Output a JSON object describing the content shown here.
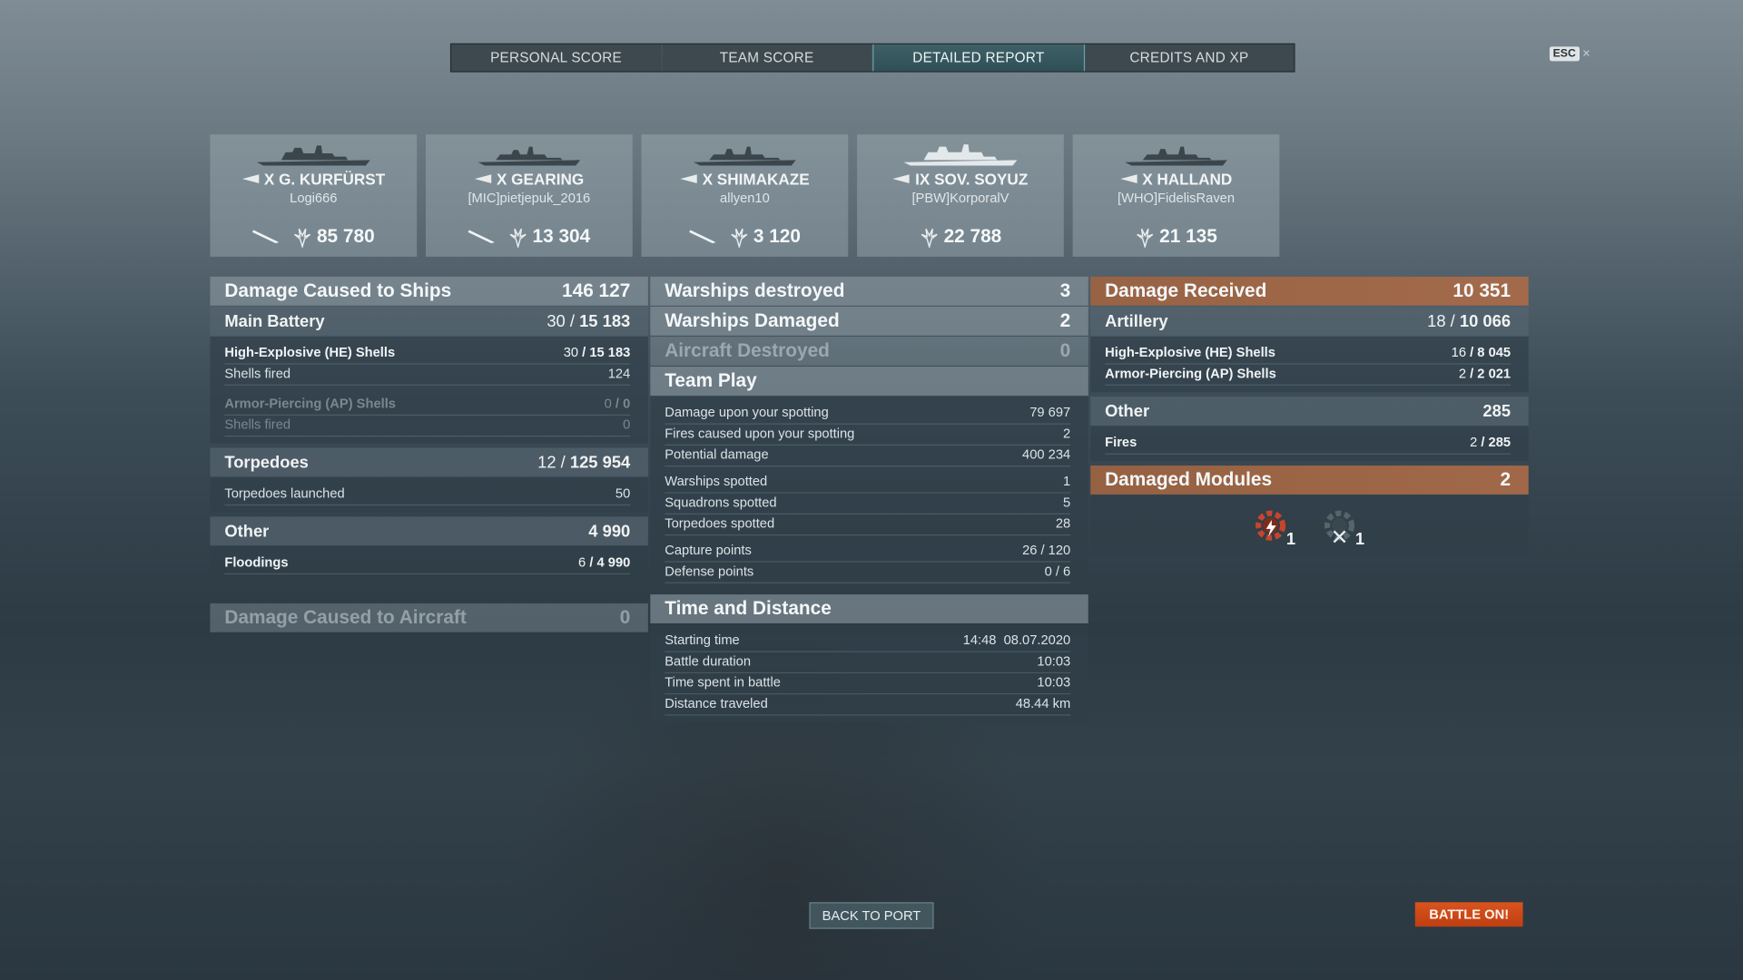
{
  "tabs": [
    {
      "label": "PERSONAL SCORE"
    },
    {
      "label": "TEAM SCORE"
    },
    {
      "label": "DETAILED REPORT",
      "active": true
    },
    {
      "label": "CREDITS AND XP"
    }
  ],
  "esc": {
    "key": "ESC",
    "close": "×"
  },
  "players": [
    {
      "ship": "X G. KURFÜRST",
      "name": "Logi666",
      "damage": "85 780"
    },
    {
      "ship": "X GEARING",
      "name": "[MIC]pietjepuk_2016",
      "damage": "13 304"
    },
    {
      "ship": "X SHIMAKAZE",
      "name": "allyen10",
      "damage": "3 120"
    },
    {
      "ship": "IX SOV. SOYUZ",
      "name": "[PBW]KorporalV",
      "damage": "22 788"
    },
    {
      "ship": "X HALLAND",
      "name": "[WHO]FidelisRaven",
      "damage": "21 135"
    }
  ],
  "damage_caused": {
    "title": "Damage Caused to Ships",
    "total": "146 127",
    "main_battery": {
      "label": "Main Battery",
      "hits": "30",
      "value": "15 183"
    },
    "he": {
      "label": "High-Explosive (HE) Shells",
      "hits": "30",
      "value": "15 183",
      "fired_label": "Shells fired",
      "fired": "124"
    },
    "ap": {
      "label": "Armor-Piercing (AP) Shells",
      "hits": "0",
      "value": "0",
      "fired_label": "Shells fired",
      "fired": "0"
    },
    "torpedoes": {
      "label": "Torpedoes",
      "hits": "12",
      "value": "125 954",
      "launched_label": "Torpedoes launched",
      "launched": "50"
    },
    "other": {
      "label": "Other",
      "value": "4 990",
      "floodings_label": "Floodings",
      "floodings_hits": "6",
      "floodings_value": "4 990"
    },
    "aircraft": {
      "label": "Damage Caused to Aircraft",
      "value": "0"
    }
  },
  "middle": {
    "destroyed": {
      "label": "Warships destroyed",
      "value": "3"
    },
    "damaged": {
      "label": "Warships Damaged",
      "value": "2"
    },
    "aircraft": {
      "label": "Aircraft Destroyed",
      "value": "0"
    },
    "team_play": {
      "title": "Team Play",
      "rows": [
        {
          "label": "Damage upon your spotting",
          "value": "79 697"
        },
        {
          "label": "Fires caused upon your spotting",
          "value": "2"
        },
        {
          "label": "Potential damage",
          "value": "400 234"
        },
        {
          "label": "Warships spotted",
          "value": "1"
        },
        {
          "label": "Squadrons spotted",
          "value": "5"
        },
        {
          "label": "Torpedoes spotted",
          "value": "28"
        },
        {
          "label": "Capture points",
          "value": "26 / 120"
        },
        {
          "label": "Defense points",
          "value": "0 / 6"
        }
      ]
    },
    "time": {
      "title": "Time and Distance",
      "rows": [
        {
          "label": "Starting time",
          "value": "14:48  08.07.2020"
        },
        {
          "label": "Battle duration",
          "value": "10:03"
        },
        {
          "label": "Time spent in battle",
          "value": "10:03"
        },
        {
          "label": "Distance traveled",
          "value": "48.44 km"
        }
      ]
    }
  },
  "received": {
    "title": "Damage Received",
    "total": "10 351",
    "artillery": {
      "label": "Artillery",
      "hits": "18",
      "value": "10 066"
    },
    "he": {
      "label": "High-Explosive (HE) Shells",
      "hits": "16",
      "value": "8 045"
    },
    "ap": {
      "label": "Armor-Piercing (AP) Shells",
      "hits": "2",
      "value": "2 021"
    },
    "other": {
      "label": "Other",
      "value": "285",
      "fires_label": "Fires",
      "fires_hits": "2",
      "fires_value": "285"
    },
    "modules": {
      "label": "Damaged Modules",
      "value": "2",
      "items": [
        {
          "icon": "engine-damaged-icon",
          "count": "1"
        },
        {
          "icon": "steering-gear-icon",
          "count": "1"
        }
      ]
    }
  },
  "buttons": {
    "port": "BACK TO PORT",
    "battle": "BATTLE ON!"
  },
  "colors": {
    "accent": "#5fa7a6",
    "orange": "#a86a47",
    "battle": "#cf4a17"
  }
}
